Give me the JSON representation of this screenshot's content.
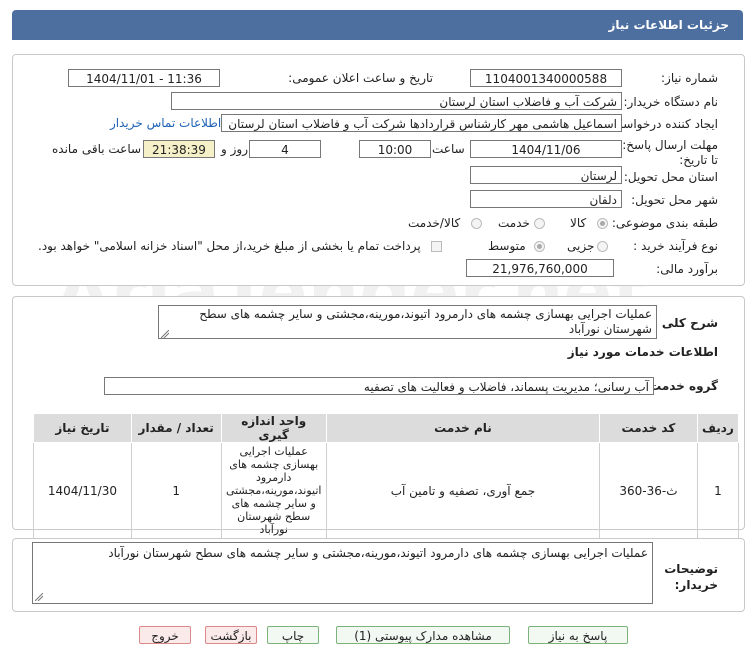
{
  "header": {
    "title": "جزئیات اطلاعات نیاز"
  },
  "form": {
    "need_number_label": "شماره نیاز:",
    "need_number": "1104001340000588",
    "announce_label": "تاریخ و ساعت اعلان عمومی:",
    "announce_value": "1404/11/01 - 11:36",
    "buyer_org_label": "نام دستگاه خریدار:",
    "buyer_org": "شرکت آب و فاضلاب استان لرستان",
    "creator_label": "ایجاد کننده درخواست:",
    "creator": "اسماعیل هاشمی مهر کارشناس قراردادها شرکت آب و فاضلاب استان لرستان",
    "contact_link": "اطلاعات تماس خریدار",
    "deadline_label": "مهلت ارسال پاسخ: تا تاریخ:",
    "deadline_date": "1404/11/06",
    "time_label": "ساعت",
    "deadline_time": "10:00",
    "days_value": "4",
    "days_label": "روز و",
    "remaining_value": "21:38:39",
    "remaining_label": "ساعت باقی مانده",
    "province_label": "استان محل تحویل:",
    "province": "لرستان",
    "city_label": "شهر محل تحویل:",
    "city": "دلفان",
    "category_label": "طبقه بندی موضوعی:",
    "category_options": [
      "کالا",
      "خدمت",
      "کالا/خدمت"
    ],
    "process_label": "نوع فرآیند خرید :",
    "process_options": [
      "جزیی",
      "متوسط"
    ],
    "payment_note": "پرداخت تمام یا بخشی از مبلغ خرید،از محل \"اسناد خزانه اسلامی\" خواهد بود.",
    "estimate_label": "برآورد مالی:",
    "estimate": "21,976,760,000"
  },
  "summary": {
    "label": "شرح کلی نیاز:",
    "text": "عملیات اجرایی بهسازی چشمه های دارمرود اتیوند،مورینه،مجشتی و سایر چشمه های سطح شهرستان نورآباد"
  },
  "services": {
    "section_title": "اطلاعات خدمات مورد نیاز",
    "group_label": "گروه خدمت:",
    "group_value": "آب رسانی؛ مدیریت پسماند، فاضلاب و فعالیت های تصفیه",
    "columns": [
      "ردیف",
      "کد خدمت",
      "نام خدمت",
      "واحد اندازه گیری",
      "تعداد / مقدار",
      "تاریخ نیاز"
    ],
    "rows": [
      {
        "row": "1",
        "code": "ث-36-360",
        "name": "جمع آوری، تصفیه و تامین آب",
        "unit": "عملیات اجرایی بهسازی چشمه های دارمرود اتیوند،مورینه،مجشتی و سایر چشمه های سطح شهرستان نورآباد",
        "qty": "1",
        "date": "1404/11/30"
      }
    ]
  },
  "buyer_notes": {
    "label": "توضیحات خریدار:",
    "text": "عملیات اجرایی بهسازی چشمه های دارمرود اتیوند،مورینه،مجشتی و سایر چشمه های سطح شهرستان نورآباد"
  },
  "buttons": {
    "respond": "پاسخ به نیاز",
    "attachments": "مشاهده مدارک پیوستی (1)",
    "print": "چاپ",
    "back": "بازگشت",
    "exit": "خروج"
  },
  "watermark": "AriaTender.net"
}
